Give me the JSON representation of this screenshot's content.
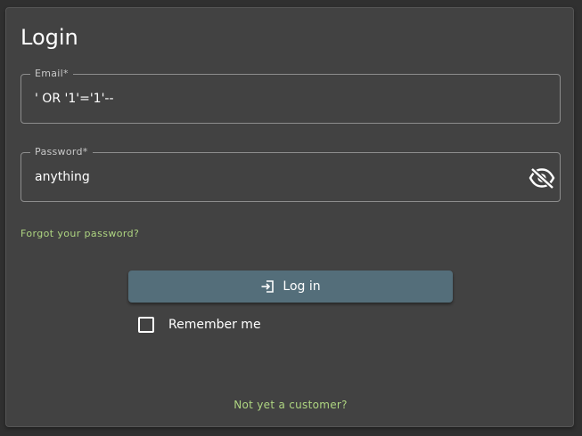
{
  "login": {
    "title": "Login",
    "email": {
      "label": "Email*",
      "value": "' OR '1'='1'--"
    },
    "password": {
      "label": "Password*",
      "value": "anything",
      "visibility_icon": "eye-off-icon"
    },
    "forgot_password": "Forgot your password?",
    "login_button": {
      "label": "Log in",
      "icon": "login-icon"
    },
    "remember_me": {
      "label": "Remember me",
      "checked": false
    },
    "register_link": "Not yet a customer?"
  },
  "colors": {
    "background": "#303030",
    "card": "#424242",
    "accent_link": "#aed581",
    "button": "#546e7a",
    "text": "#ffffff"
  }
}
